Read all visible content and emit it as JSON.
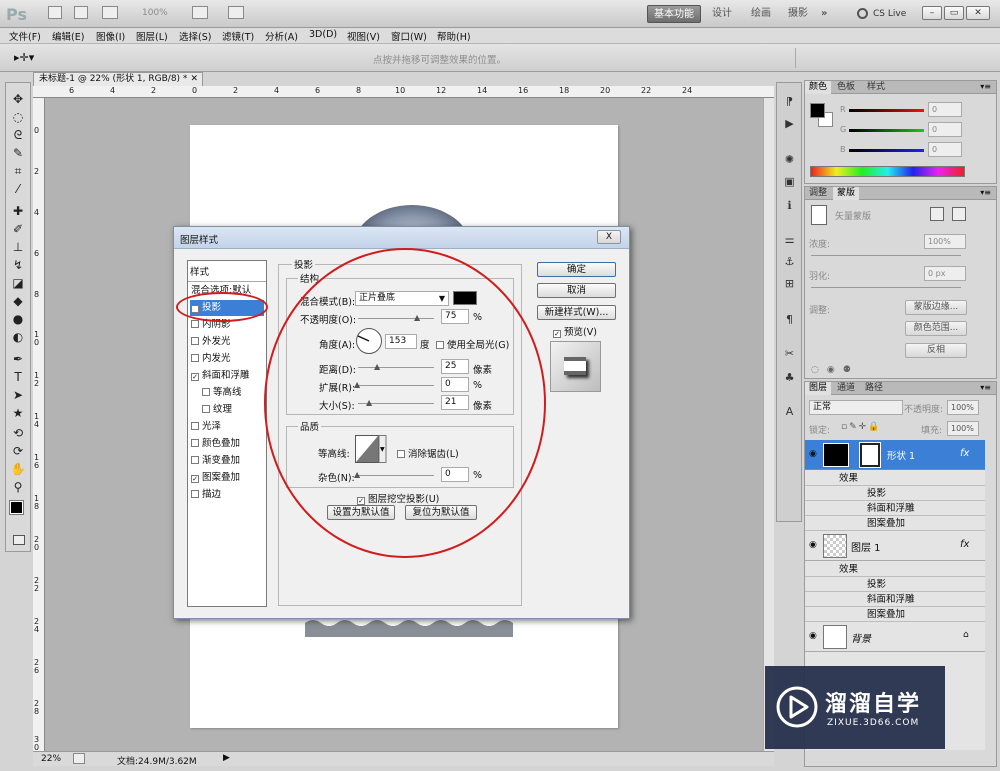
{
  "titlebar": {
    "logo": "Ps",
    "zoom": "100%",
    "workspaces": [
      "基本功能",
      "设计",
      "绘画",
      "摄影",
      "»"
    ],
    "cslive": "CS Live"
  },
  "menu": [
    "文件(F)",
    "编辑(E)",
    "图像(I)",
    "图层(L)",
    "选择(S)",
    "滤镜(T)",
    "分析(A)",
    "3D(D)",
    "视图(V)",
    "窗口(W)",
    "帮助(H)"
  ],
  "options": {
    "hint": "点按并拖移可调整效果的位置。"
  },
  "document": {
    "tab_title": "未标题-1 @ 22% (形状 1, RGB/8) *",
    "ruler_top": [
      "6",
      "4",
      "2",
      "0",
      "2",
      "4",
      "6",
      "8",
      "10",
      "12",
      "14",
      "16",
      "18",
      "20",
      "22",
      "24"
    ],
    "ruler_left": [
      "0",
      "2",
      "4",
      "6",
      "8",
      "1 0",
      "1 2",
      "1 4",
      "1 6",
      "1 8",
      "2 0",
      "2 2",
      "2 4",
      "2 6",
      "2 8",
      "3 0"
    ],
    "zoom": "22%",
    "doc_info": "文档:24.9M/3.62M"
  },
  "color_panel": {
    "tabs": [
      "颜色",
      "色板",
      "样式"
    ],
    "labels": [
      "R",
      "G",
      "B"
    ],
    "values": [
      "0",
      "0",
      "0"
    ]
  },
  "adjust_panel": {
    "tabs": [
      "调整",
      "蒙版"
    ],
    "vector_mask": "矢量蒙版",
    "density_label": "浓度:",
    "density": "100%",
    "feather_label": "羽化:",
    "feather": "0 px",
    "refine_label": "调整:",
    "buttons": [
      "蒙版边缘...",
      "颜色范围...",
      "反相"
    ]
  },
  "layers_panel": {
    "tabs": [
      "图层",
      "通道",
      "路径"
    ],
    "blend": "正常",
    "opacity_label": "不透明度:",
    "opacity": "100%",
    "lock_label": "锁定:",
    "fill_label": "填充:",
    "fill": "100%",
    "layers": [
      {
        "name": "形状 1",
        "effects_label": "效果",
        "effects": [
          "投影",
          "斜面和浮雕",
          "图案叠加"
        ],
        "fx": "fx"
      },
      {
        "name": "图层 1",
        "effects_label": "效果",
        "effects": [
          "投影",
          "斜面和浮雕",
          "图案叠加"
        ],
        "fx": "fx"
      },
      {
        "name": "背景"
      }
    ]
  },
  "dialog": {
    "title": "图层样式",
    "close": "X",
    "styles_header": "样式",
    "style_items": [
      {
        "label": "混合选项:默认",
        "checked": false,
        "indent": false,
        "checkbox": false
      },
      {
        "label": "投影",
        "checked": true,
        "indent": false,
        "checkbox": true,
        "selected": true
      },
      {
        "label": "内阴影",
        "checked": false,
        "indent": false,
        "checkbox": true
      },
      {
        "label": "外发光",
        "checked": false,
        "indent": false,
        "checkbox": true
      },
      {
        "label": "内发光",
        "checked": false,
        "indent": false,
        "checkbox": true
      },
      {
        "label": "斜面和浮雕",
        "checked": true,
        "indent": false,
        "checkbox": true
      },
      {
        "label": "等高线",
        "checked": false,
        "indent": true,
        "checkbox": true
      },
      {
        "label": "纹理",
        "checked": false,
        "indent": true,
        "checkbox": true
      },
      {
        "label": "光泽",
        "checked": false,
        "indent": false,
        "checkbox": true
      },
      {
        "label": "颜色叠加",
        "checked": false,
        "indent": false,
        "checkbox": true
      },
      {
        "label": "渐变叠加",
        "checked": false,
        "indent": false,
        "checkbox": true
      },
      {
        "label": "图案叠加",
        "checked": true,
        "indent": false,
        "checkbox": true
      },
      {
        "label": "描边",
        "checked": false,
        "indent": false,
        "checkbox": true
      }
    ],
    "section_title": "投影",
    "structure_title": "结构",
    "blend_mode_label": "混合模式(B):",
    "blend_mode": "正片叠底",
    "opacity_label": "不透明度(O):",
    "opacity": "75",
    "angle_label": "角度(A):",
    "angle": "153",
    "angle_unit": "度",
    "global_light": "使用全局光(G)",
    "distance_label": "距离(D):",
    "distance": "25",
    "spread_label": "扩展(R):",
    "spread": "0",
    "size_label": "大小(S):",
    "size": "21",
    "unit_px": "像素",
    "unit_pct": "%",
    "quality_title": "品质",
    "contour_label": "等高线:",
    "antialias": "消除锯齿(L)",
    "noise_label": "杂色(N):",
    "noise": "0",
    "knockout": "图层挖空投影(U)",
    "make_default": "设置为默认值",
    "reset_default": "复位为默认值",
    "buttons": {
      "ok": "确定",
      "cancel": "取消",
      "new_style": "新建样式(W)...",
      "preview": "预览(V)"
    }
  },
  "watermark": {
    "brand": "溜溜自学",
    "url": "ZIXUE.3D66.COM"
  },
  "colors": {
    "accent_blue": "#3b7fd6",
    "selection_red": "#d21c1c",
    "watermark_bg": "#26304c"
  }
}
